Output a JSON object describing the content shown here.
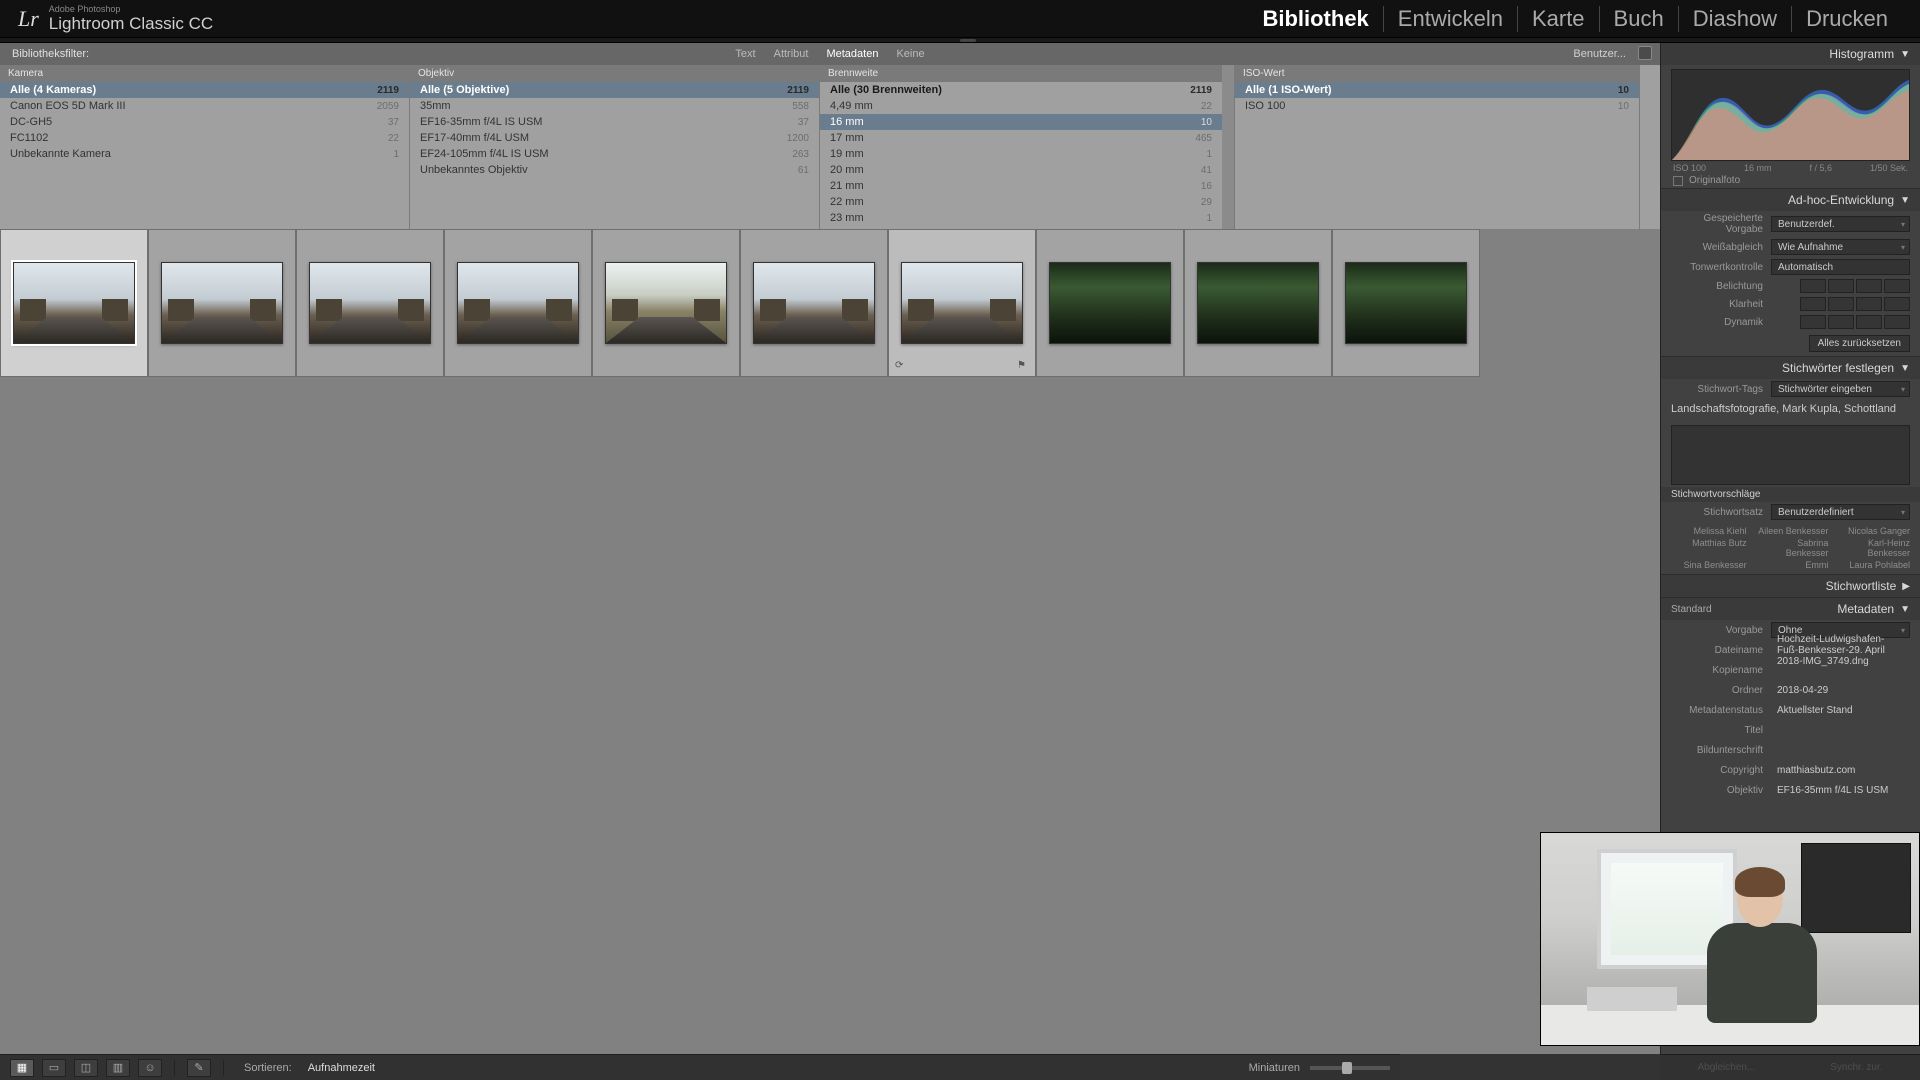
{
  "brand": {
    "sub": "Adobe Photoshop",
    "name": "Lightroom Classic CC",
    "logo": "Lr"
  },
  "modules": [
    "Bibliothek",
    "Entwickeln",
    "Karte",
    "Buch",
    "Diashow",
    "Drucken"
  ],
  "active_module": "Bibliothek",
  "filterbar": {
    "label": "Bibliotheksfilter:",
    "tabs": [
      "Text",
      "Attribut",
      "Metadaten",
      "Keine"
    ],
    "active_tab": "Metadaten",
    "preset": "Benutzer..."
  },
  "filters": {
    "camera": {
      "head": "Kamera",
      "rows": [
        {
          "n": "Alle (4 Kameras)",
          "c": "2119",
          "total": true,
          "sel": true
        },
        {
          "n": "Canon EOS 5D Mark III",
          "c": "2059"
        },
        {
          "n": "DC-GH5",
          "c": "37"
        },
        {
          "n": "FC1102",
          "c": "22"
        },
        {
          "n": "Unbekannte Kamera",
          "c": "1"
        }
      ]
    },
    "lens": {
      "head": "Objektiv",
      "rows": [
        {
          "n": "Alle (5 Objektive)",
          "c": "2119",
          "total": true,
          "sel": true
        },
        {
          "n": "35mm",
          "c": "558"
        },
        {
          "n": "EF16-35mm f/4L IS USM",
          "c": "37"
        },
        {
          "n": "EF17-40mm f/4L USM",
          "c": "1200"
        },
        {
          "n": "EF24-105mm f/4L IS USM",
          "c": "263"
        },
        {
          "n": "Unbekanntes Objektiv",
          "c": "61"
        }
      ]
    },
    "focal": {
      "head": "Brennweite",
      "rows": [
        {
          "n": "Alle (30 Brennweiten)",
          "c": "2119",
          "total": true
        },
        {
          "n": "4,49 mm",
          "c": "22"
        },
        {
          "n": "16 mm",
          "c": "10",
          "sel": true
        },
        {
          "n": "17 mm",
          "c": "465"
        },
        {
          "n": "19 mm",
          "c": "1"
        },
        {
          "n": "20 mm",
          "c": "41"
        },
        {
          "n": "21 mm",
          "c": "16"
        },
        {
          "n": "22 mm",
          "c": "29"
        },
        {
          "n": "23 mm",
          "c": "1"
        }
      ]
    },
    "iso": {
      "head": "ISO-Wert",
      "rows": [
        {
          "n": "Alle (1 ISO-Wert)",
          "c": "10",
          "total": true,
          "sel": true
        },
        {
          "n": "ISO 100",
          "c": "10"
        }
      ]
    }
  },
  "thumbs": [
    {
      "kind": "city",
      "sel": true
    },
    {
      "kind": "city"
    },
    {
      "kind": "city"
    },
    {
      "kind": "city"
    },
    {
      "kind": "city-bright"
    },
    {
      "kind": "city"
    },
    {
      "kind": "city",
      "hover": true
    },
    {
      "kind": "green"
    },
    {
      "kind": "green"
    },
    {
      "kind": "green"
    }
  ],
  "right": {
    "histogram_title": "Histogramm",
    "histo_info": {
      "iso": "ISO 100",
      "focal": "16 mm",
      "ap": "f / 5,6",
      "sh": "1/50 Sek."
    },
    "orig": "Originalfoto",
    "quick": {
      "title": "Ad-hoc-Entwicklung",
      "preset_k": "Gespeicherte Vorgabe",
      "preset_v": "Benutzerdef.",
      "wb_k": "Weißabgleich",
      "wb_v": "Wie Aufnahme",
      "tone_k": "Tonwertkontrolle",
      "tone_v": "Automatisch",
      "exp_k": "Belichtung",
      "clar_k": "Klarheit",
      "dyn_k": "Dynamik",
      "reset": "Alles zurücksetzen"
    },
    "keywording": {
      "title": "Stichwörter festlegen",
      "tags_k": "Stichwort-Tags",
      "tags_v": "Stichwörter eingeben",
      "tags": "Landschaftsfotografie, Mark Kupla, Schottland",
      "sugg_title": "Stichwortvorschläge",
      "set_k": "Stichwortsatz",
      "set_v": "Benutzerdefiniert",
      "sugg": [
        "Melissa Kiehl",
        "Aileen Benkesser",
        "Nicolas Ganger",
        "Matthias Butz",
        "Sabrina Benkesser",
        "Karl-Heinz Benkesser",
        "Sina Benkesser",
        "Emmi",
        "Laura Pohlabel"
      ]
    },
    "keywordlist_title": "Stichwortliste",
    "metadata": {
      "title": "Metadaten",
      "mode": "Standard",
      "rows": [
        {
          "k": "Vorgabe",
          "v": "Ohne",
          "dd": true
        },
        {
          "k": "Dateiname",
          "v": "Hochzeit-Ludwigshafen-Fuß-Benkesser-29. April 2018-IMG_3749.dng"
        },
        {
          "k": "Kopiename",
          "v": ""
        },
        {
          "k": "Ordner",
          "v": "2018-04-29"
        },
        {
          "k": "Metadatenstatus",
          "v": "Aktuellster Stand"
        },
        {
          "k": "Titel",
          "v": ""
        },
        {
          "k": "Bildunterschrift",
          "v": ""
        },
        {
          "k": "Copyright",
          "v": "matthiasbutz.com"
        }
      ],
      "lens_k": "Objektiv",
      "lens_v": "EF16-35mm f/4L IS USM"
    }
  },
  "toolbar": {
    "sort_k": "Sortieren:",
    "sort_v": "Aufnahmezeit",
    "thumb_label": "Miniaturen"
  },
  "sync": {
    "a": "Abgleichen...",
    "b": "Synchr. zur."
  }
}
